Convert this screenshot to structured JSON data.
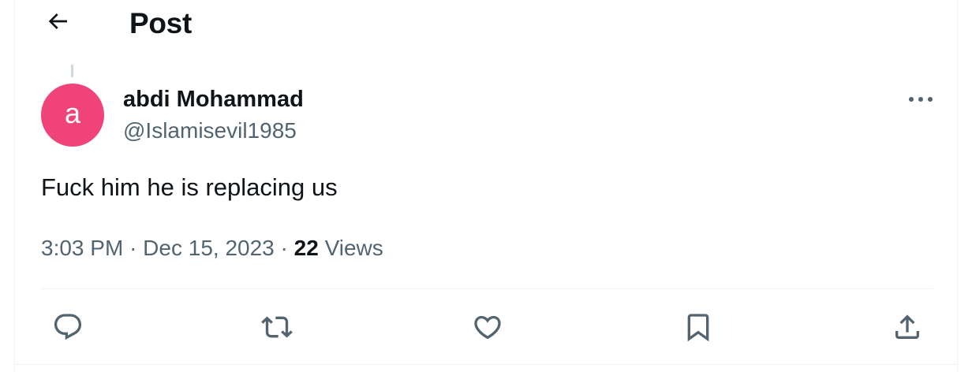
{
  "header": {
    "title": "Post",
    "back_icon": "arrow-left-icon"
  },
  "post": {
    "author": {
      "avatar_letter": "a",
      "avatar_color": "#f0437a",
      "display_name": "abdi Mohammad",
      "handle": "@Islamisevil1985"
    },
    "text": "Fuck him he is replacing us",
    "time": "3:03 PM",
    "separator": "·",
    "date": "Dec 15, 2023",
    "views_count": "22",
    "views_label": "Views"
  },
  "actions": [
    {
      "name": "reply",
      "icon": "reply-icon"
    },
    {
      "name": "repost",
      "icon": "repost-icon"
    },
    {
      "name": "like",
      "icon": "heart-icon"
    },
    {
      "name": "bookmark",
      "icon": "bookmark-icon"
    },
    {
      "name": "share",
      "icon": "share-icon"
    }
  ],
  "colors": {
    "text_primary": "#0f1419",
    "text_secondary": "#536471",
    "border": "#eff3f4",
    "thread_line": "#cfd9de"
  }
}
